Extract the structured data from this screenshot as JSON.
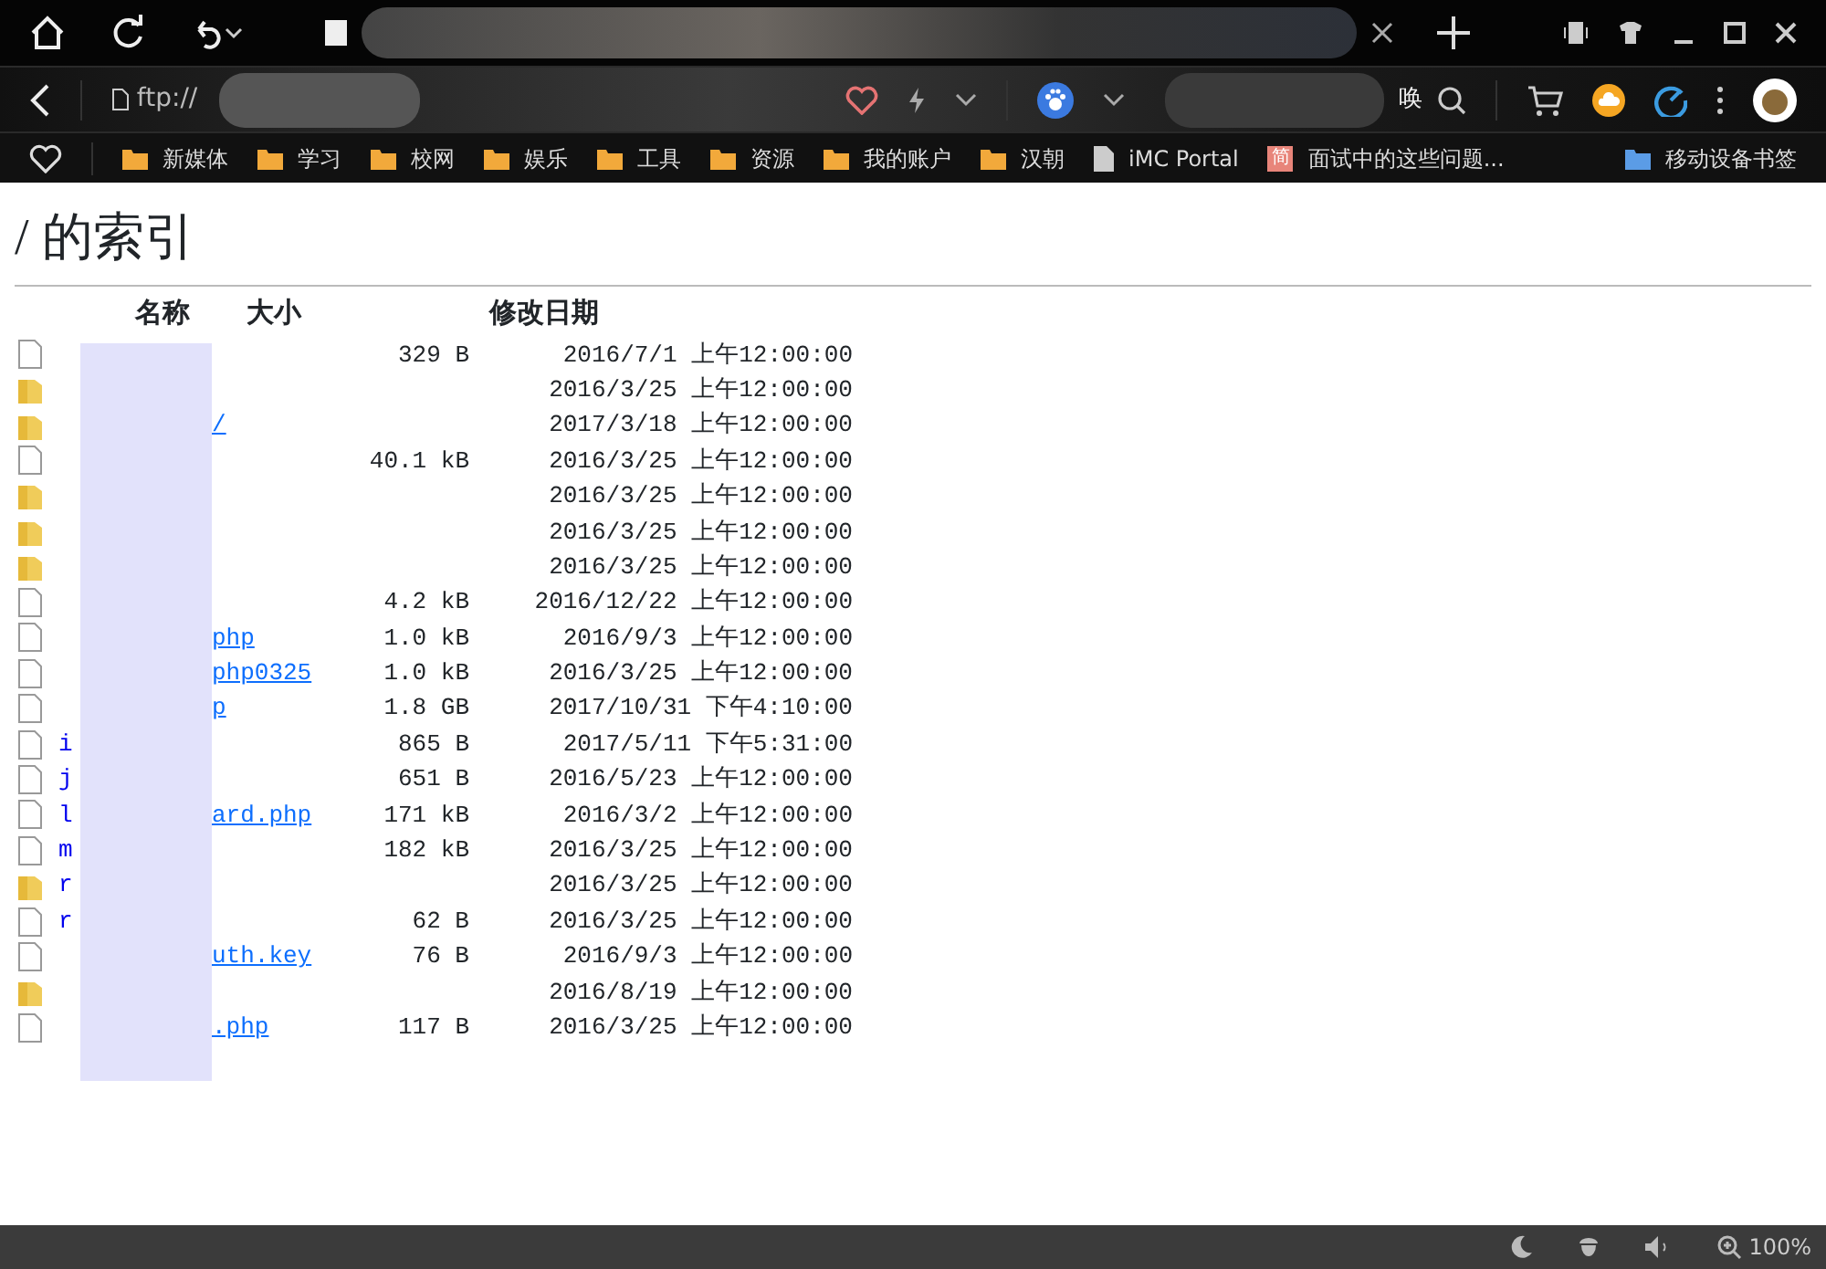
{
  "address_bar": {
    "text": "ftp://"
  },
  "search_box": {
    "text": "唤"
  },
  "bookmarks": [
    {
      "kind": "folder",
      "label": "新媒体"
    },
    {
      "kind": "folder",
      "label": "学习"
    },
    {
      "kind": "folder",
      "label": "校网"
    },
    {
      "kind": "folder",
      "label": "娱乐"
    },
    {
      "kind": "folder",
      "label": "工具"
    },
    {
      "kind": "folder",
      "label": "资源"
    },
    {
      "kind": "folder",
      "label": "我的账户"
    },
    {
      "kind": "folder",
      "label": "汉朝"
    },
    {
      "kind": "page",
      "label": "iMC Portal"
    },
    {
      "kind": "site",
      "icon_text": "简",
      "label": "面试中的这些问题..."
    }
  ],
  "mobile_bookmarks": {
    "label": "移动设备书签"
  },
  "page": {
    "heading": "/ 的索引",
    "columns": [
      "名称",
      "大小",
      "修改日期"
    ],
    "rows": [
      {
        "kind": "file",
        "size": "329 B",
        "date": "2016/7/1 上午12:00:00"
      },
      {
        "kind": "folder",
        "date": "2016/3/25 上午12:00:00"
      },
      {
        "kind": "folder",
        "name_end": "/",
        "date": "2017/3/18 上午12:00:00"
      },
      {
        "kind": "file",
        "size": "40.1 kB",
        "date": "2016/3/25 上午12:00:00"
      },
      {
        "kind": "folder",
        "date": "2016/3/25 上午12:00:00"
      },
      {
        "kind": "folder",
        "date": "2016/3/25 上午12:00:00"
      },
      {
        "kind": "folder",
        "date": "2016/3/25 上午12:00:00"
      },
      {
        "kind": "file",
        "size": "4.2 kB",
        "date": "2016/12/22 上午12:00:00"
      },
      {
        "kind": "file",
        "name_end": "php",
        "size": "1.0 kB",
        "date": "2016/9/3 上午12:00:00"
      },
      {
        "kind": "file",
        "name_end": "php0325",
        "size": "1.0 kB",
        "date": "2016/3/25 上午12:00:00"
      },
      {
        "kind": "file",
        "name_end": "p",
        "size": "1.8 GB",
        "date": "2017/10/31 下午4:10:00"
      },
      {
        "kind": "file",
        "name_start": "i",
        "size": "865 B",
        "date": "2017/5/11 下午5:31:00"
      },
      {
        "kind": "file",
        "name_start": "j",
        "size": "651 B",
        "date": "2016/5/23 上午12:00:00"
      },
      {
        "kind": "file",
        "name_start": "l",
        "name_end": "ard.php",
        "size": "171 kB",
        "date": "2016/3/2 上午12:00:00"
      },
      {
        "kind": "file",
        "name_start": "m",
        "size": "182 kB",
        "date": "2016/3/25 上午12:00:00"
      },
      {
        "kind": "folder",
        "name_start": "r",
        "date": "2016/3/25 上午12:00:00"
      },
      {
        "kind": "file",
        "name_start": "r",
        "size": "62 B",
        "date": "2016/3/25 上午12:00:00"
      },
      {
        "kind": "file",
        "name_end": "uth.key",
        "size": "76 B",
        "date": "2016/9/3 上午12:00:00"
      },
      {
        "kind": "folder",
        "date": "2016/8/19 上午12:00:00"
      },
      {
        "kind": "file",
        "name_end": ".php",
        "size": "117 B",
        "date": "2016/3/25 上午12:00:00"
      }
    ]
  },
  "status_bar": {
    "zoom": "100%"
  }
}
